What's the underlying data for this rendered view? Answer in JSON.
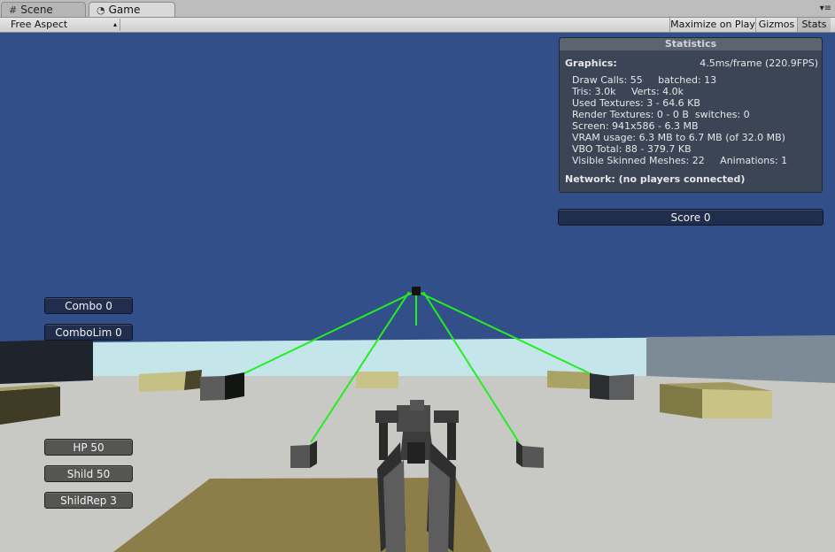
{
  "tabs": [
    {
      "label": "Scene",
      "icon": "grid-icon"
    },
    {
      "label": "Game",
      "icon": "pacman-icon"
    }
  ],
  "tab_menu_icon": "panel-menu-icon",
  "toolbar": {
    "aspect": "Free Aspect",
    "maximize": "Maximize on Play",
    "gizmos": "Gizmos",
    "stats": "Stats"
  },
  "stats": {
    "title": "Statistics",
    "graphics_label": "Graphics:",
    "graphics_value": "4.5ms/frame (220.9FPS)",
    "lines": [
      "Draw Calls: 55     batched: 13",
      "Tris: 3.0k     Verts: 4.0k",
      "Used Textures: 3 - 64.6 KB",
      "Render Textures: 0 - 0 B  switches: 0",
      "Screen: 941x586 - 6.3 MB",
      "VRAM usage: 6.3 MB to 6.7 MB (of 32.0 MB)",
      "VBO Total: 88 - 379.7 KB",
      "Visible Skinned Meshes: 22     Animations: 1"
    ],
    "network": "Network: (no players connected)"
  },
  "hud": {
    "score": "Score  0",
    "combo": "Combo  0",
    "combolim": "ComboLim  0",
    "hp": "HP  50",
    "shild": "Shild  50",
    "shildrep": "ShildRep  3"
  },
  "colors": {
    "sky": "#324f8a",
    "horizon": "#c4e6ea",
    "ground": "#c8c8c4",
    "laser": "#22ee22"
  }
}
